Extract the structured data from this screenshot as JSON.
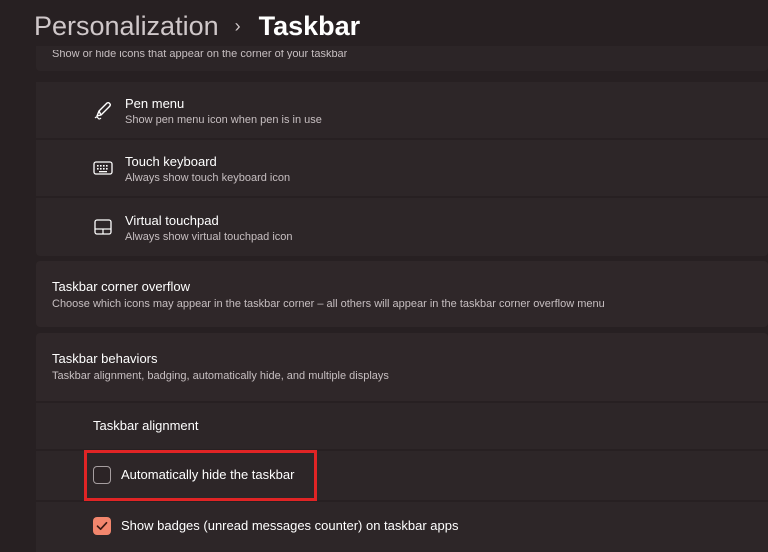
{
  "breadcrumb": {
    "parent": "Personalization",
    "separator": "›",
    "current": "Taskbar"
  },
  "truncated_section": {
    "subtitle": "Show or hide icons that appear on the corner of your taskbar"
  },
  "corner_icons": [
    {
      "icon": "pen-icon",
      "title": "Pen menu",
      "desc": "Show pen menu icon when pen is in use"
    },
    {
      "icon": "keyboard-icon",
      "title": "Touch keyboard",
      "desc": "Always show touch keyboard icon"
    },
    {
      "icon": "touchpad-icon",
      "title": "Virtual touchpad",
      "desc": "Always show virtual touchpad icon"
    }
  ],
  "overflow_section": {
    "title": "Taskbar corner overflow",
    "desc": "Choose which icons may appear in the taskbar corner – all others will appear in the taskbar corner overflow menu"
  },
  "behaviors_section": {
    "title": "Taskbar behaviors",
    "desc": "Taskbar alignment, badging, automatically hide, and multiple displays",
    "alignment_label": "Taskbar alignment",
    "auto_hide": {
      "label": "Automatically hide the taskbar",
      "checked": false
    },
    "badges": {
      "label": "Show badges (unread messages counter) on taskbar apps",
      "checked": true
    }
  },
  "colors": {
    "accent": "#f2866d",
    "highlight_box": "#e02425",
    "background": "#272022"
  }
}
